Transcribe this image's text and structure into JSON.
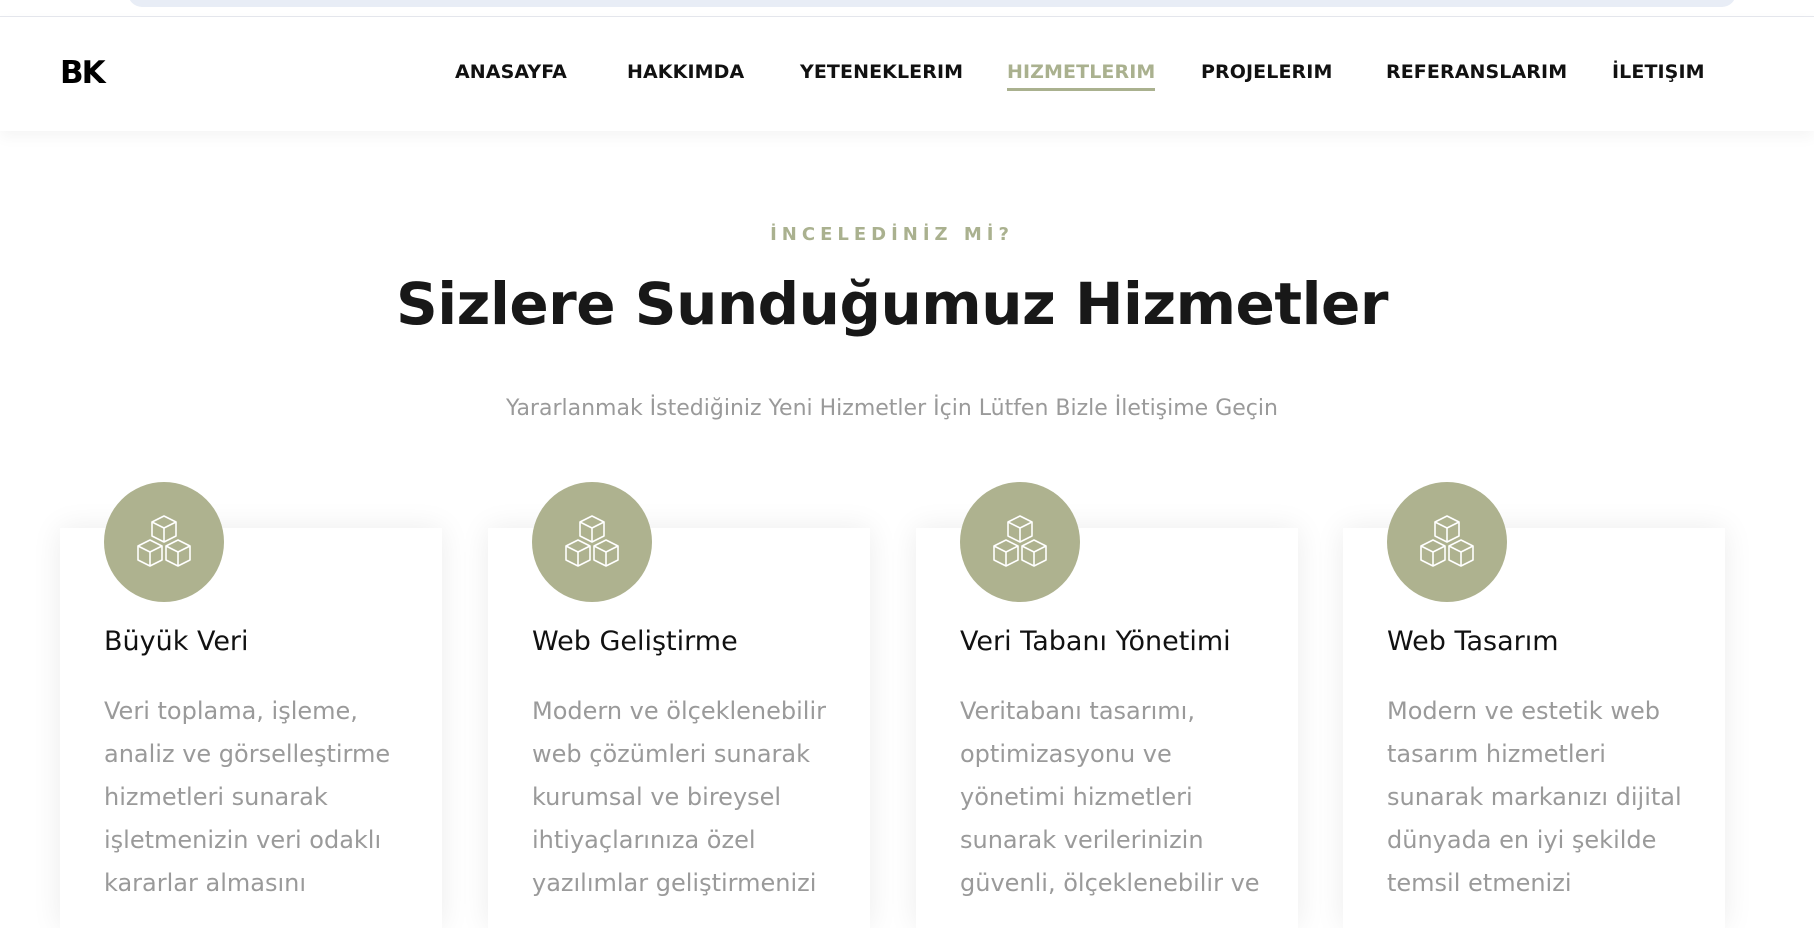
{
  "brand": {
    "logo": "BK"
  },
  "nav": {
    "items": [
      {
        "label": "ANASAYFA",
        "active": false
      },
      {
        "label": "HAKKIMDA",
        "active": false
      },
      {
        "label": "YETENEKLERIM",
        "active": false
      },
      {
        "label": "HIZMETLERIM",
        "active": true
      },
      {
        "label": "PROJELERIM",
        "active": false
      },
      {
        "label": "REFERANSLARIM",
        "active": false
      },
      {
        "label": "İLETIŞIM",
        "active": false
      }
    ]
  },
  "services": {
    "eyebrow": "İNCELEDİNİZ Mİ?",
    "title": "Sizlere Sunduğumuz Hizmetler",
    "subtitle": "Yararlanmak İstediğiniz Yeni Hizmetler İçin Lütfen Bizle İletişime Geçin",
    "cards": [
      {
        "icon": "cubes-icon",
        "title": "Büyük Veri",
        "text": "Veri toplama, işleme, analiz ve görselleştirme hizmetleri sunarak işletmenizin veri odaklı kararlar almasını"
      },
      {
        "icon": "cubes-icon",
        "title": "Web Geliştirme",
        "text": "Modern ve ölçeklenebilir web çözümleri sunarak kurumsal ve bireysel ihtiyaçlarınıza özel yazılımlar geliştirmenizi"
      },
      {
        "icon": "cubes-icon",
        "title": "Veri Tabanı Yönetimi",
        "text": "Veritabanı tasarımı, optimizasyonu ve yönetimi hizmetleri sunarak verilerinizin güvenli, ölçeklenebilir ve"
      },
      {
        "icon": "cubes-icon",
        "title": "Web Tasarım",
        "text": "Modern ve estetik web tasarım hizmetleri sunarak markanızı dijital dünyada en iyi şekilde temsil etmenizi"
      }
    ]
  },
  "colors": {
    "accent": "#aab18f",
    "icon_bg": "#aeb28f",
    "text_dark": "#111111",
    "text_muted": "#9a9a9a"
  }
}
